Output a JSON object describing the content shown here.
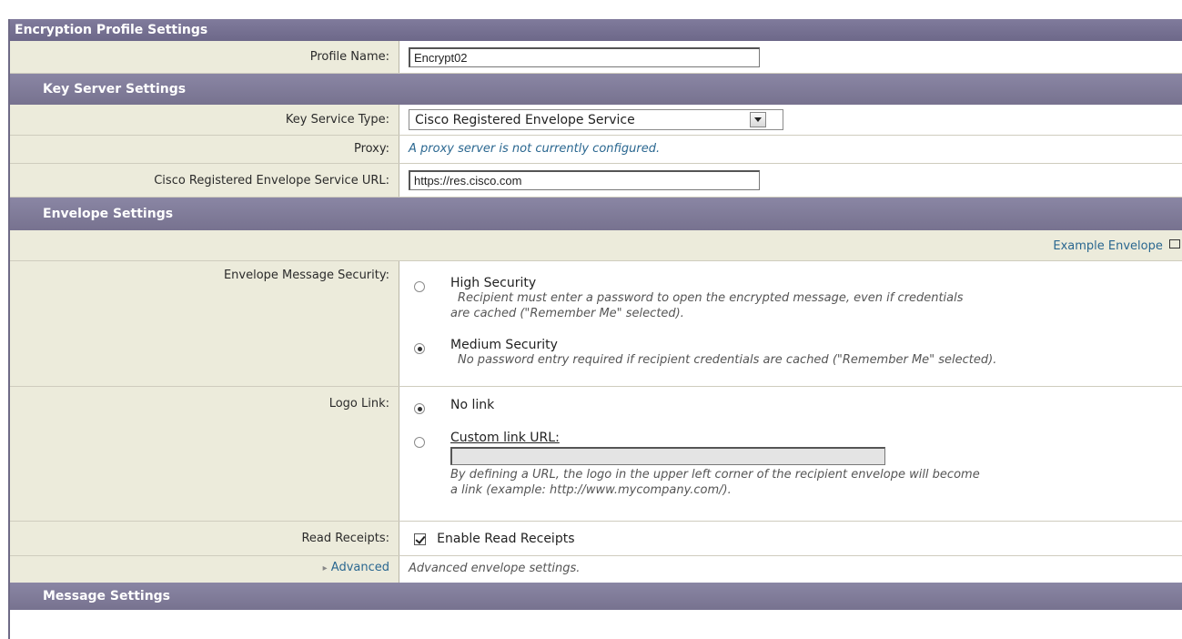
{
  "main_header": "Encryption Profile Settings",
  "profile_name": {
    "label": "Profile Name:",
    "value": "Encrypt02"
  },
  "key_server": {
    "header": "Key Server Settings",
    "service_type": {
      "label": "Key Service Type:",
      "value": "Cisco Registered Envelope Service"
    },
    "proxy": {
      "label": "Proxy:",
      "value": "A proxy server is not currently configured."
    },
    "service_url": {
      "label": "Cisco Registered Envelope Service URL:",
      "value": "https://res.cisco.com"
    }
  },
  "envelope": {
    "header": "Envelope Settings",
    "example_link": "Example Envelope",
    "message_security": {
      "label": "Envelope Message Security:",
      "options": [
        {
          "title": "High Security",
          "desc1": "Recipient must enter a password to open the encrypted message, even if credentials",
          "desc2": "are cached (\"Remember Me\" selected).",
          "selected": false
        },
        {
          "title": "Medium Security",
          "desc1": "No password entry required if recipient credentials are cached (\"Remember Me\" selected).",
          "selected": true
        }
      ]
    },
    "logo_link": {
      "label": "Logo Link:",
      "no_link": "No link",
      "custom_link": "Custom link URL:",
      "custom_value": "",
      "desc1": "By defining a URL, the logo in the upper left corner of the recipient envelope will become",
      "desc2": "a link (example: http://www.mycompany.com/).",
      "selected": "no_link"
    },
    "read_receipts": {
      "label": "Read Receipts:",
      "value": "Enable Read Receipts",
      "checked": true
    },
    "advanced": {
      "label": "Advanced",
      "desc": "Advanced envelope settings."
    }
  },
  "message_settings_header": "Message Settings"
}
